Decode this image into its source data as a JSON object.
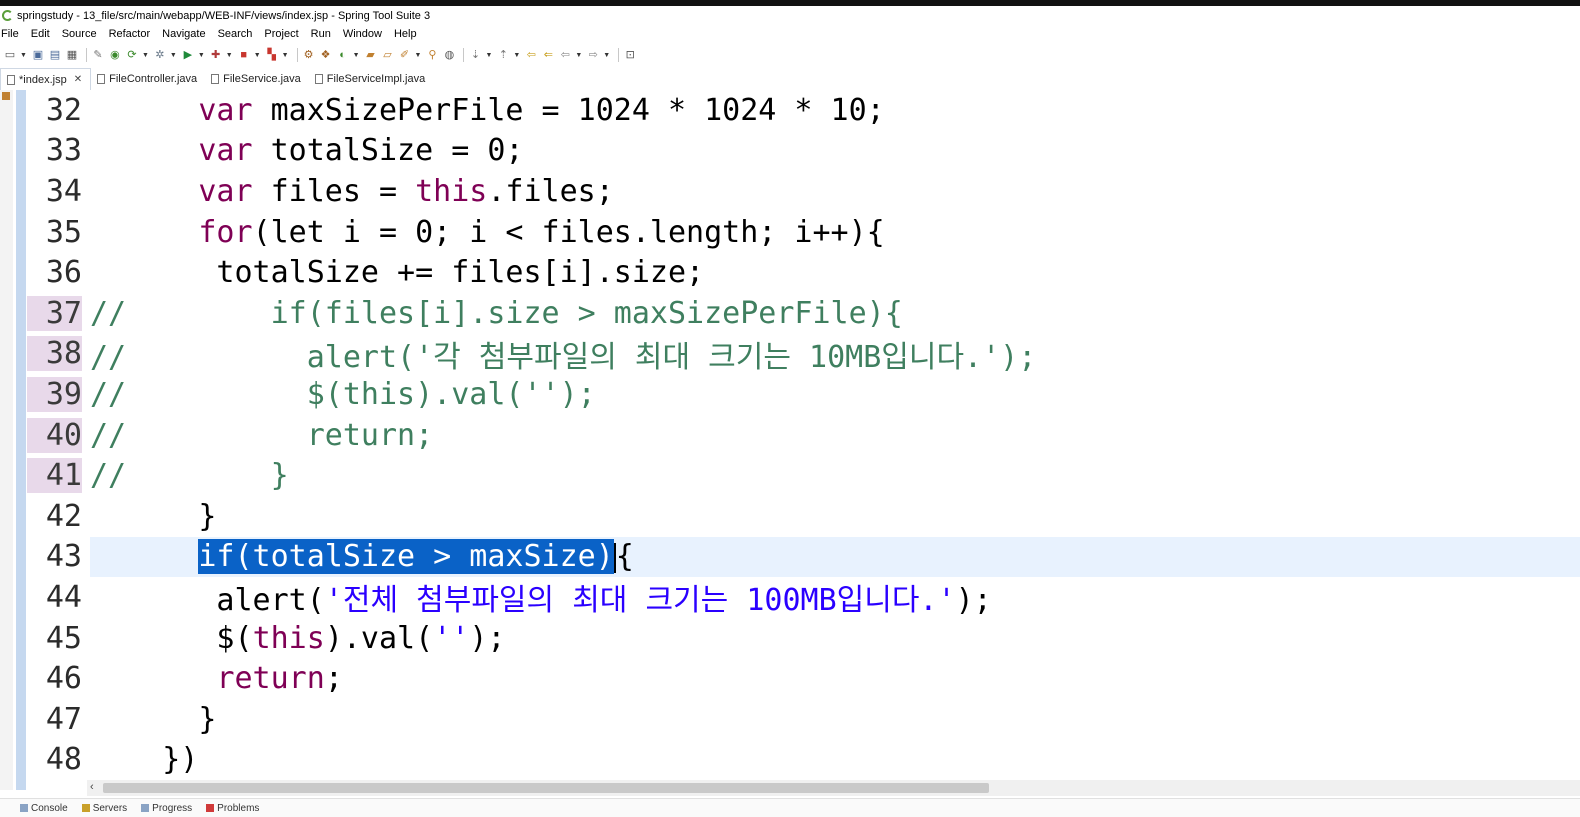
{
  "window": {
    "title": "springstudy - 13_file/src/main/webapp/WEB-INF/views/index.jsp - Spring Tool Suite 3"
  },
  "menu": [
    "File",
    "Edit",
    "Source",
    "Refactor",
    "Navigate",
    "Search",
    "Project",
    "Run",
    "Window",
    "Help"
  ],
  "tabs": [
    {
      "label": "*index.jsp",
      "active": true,
      "closable": true
    },
    {
      "label": "FileController.java",
      "active": false
    },
    {
      "label": "FileService.java",
      "active": false
    },
    {
      "label": "FileServiceImpl.java",
      "active": false
    }
  ],
  "editor": {
    "line_numbers": [
      "32",
      "33",
      "34",
      "35",
      "36",
      "37",
      "38",
      "39",
      "40",
      "41",
      "42",
      "43",
      "44",
      "45",
      "46",
      "47",
      "48"
    ],
    "current_line": "43",
    "selected_text": "if(totalSize > maxSize)"
  },
  "bottom_tabs": [
    "Console",
    "Servers",
    "Progress",
    "Problems"
  ],
  "colors": {
    "keyword": "#7f0055",
    "string": "#2a00ff",
    "comment": "#3f7f5f",
    "selection": "#0a62c7",
    "current_line": "#e8f2fe"
  }
}
